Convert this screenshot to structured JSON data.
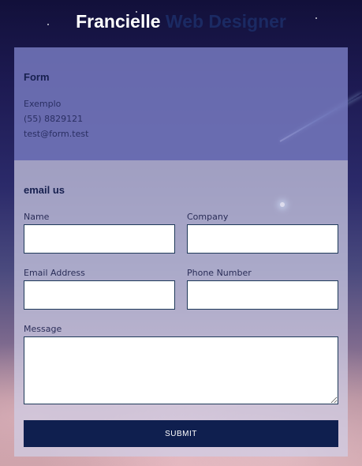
{
  "header": {
    "name": "Francielle",
    "role": "Web Designer"
  },
  "info": {
    "heading": "Form",
    "company": "Exemplo",
    "phone": "(55) 8829121",
    "email": "test@form.test"
  },
  "form": {
    "heading": "email us",
    "name_label": "Name",
    "company_label": "Company",
    "email_label": "Email Address",
    "phone_label": "Phone Number",
    "message_label": "Message",
    "name_value": "",
    "company_value": "",
    "email_value": "",
    "phone_value": "",
    "message_value": "",
    "submit_label": "SUBMIT"
  },
  "colors": {
    "title_name": "#ffffff",
    "title_role": "#1b2a63",
    "submit_bg": "#0f1f4f",
    "info_panel": "#7679be",
    "form_panel": "#d0cee6"
  }
}
